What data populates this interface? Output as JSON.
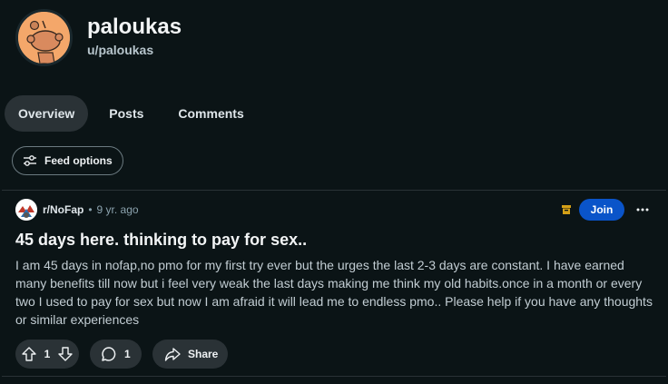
{
  "profile": {
    "display_name": "paloukas",
    "username": "u/paloukas",
    "avatar_icon": "snoo-avatar-icon"
  },
  "tabs": [
    {
      "label": "Overview",
      "active": true
    },
    {
      "label": "Posts",
      "active": false
    },
    {
      "label": "Comments",
      "active": false
    }
  ],
  "feed_options": {
    "label": "Feed options",
    "icon": "sliders-icon"
  },
  "post": {
    "subreddit": "r/NoFap",
    "separator": "•",
    "time": "9 yr. ago",
    "join_label": "Join",
    "title": "45 days here. thinking to pay for sex..",
    "body": "I am 45 days in nofap,no pmo for my first try ever but the urges the last 2-3 days are constant. I have earned many benefits till now but i feel very weak the last days making me think my old habits.once in a month or every two I used to pay for sex but now I am afraid it will lead me to endless pmo.. Please help if you have any thoughts or similar experiences",
    "votes": "1",
    "comments": "1",
    "share_label": "Share"
  },
  "colors": {
    "background": "#0b1416",
    "join": "#0a54c9",
    "archive": "#d4a017",
    "pill": "#2a3236"
  }
}
